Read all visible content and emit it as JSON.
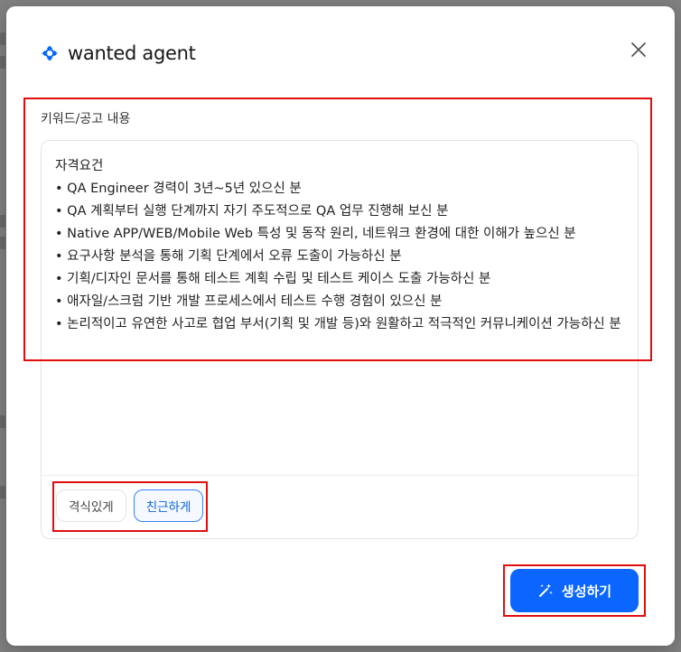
{
  "header": {
    "brand": "wanted agent",
    "brand_color": "#0066ff"
  },
  "form": {
    "field_label": "키워드/공고 내용",
    "content": "자격요건\n• QA Engineer 경력이 3년~5년 있으신 분\n• QA 계획부터 실행 단계까지 자기 주도적으로 QA 업무 진행해 보신 분\n• Native APP/WEB/Mobile Web 특성 및 동작 원리, 네트워크 환경에 대한 이해가 높으신 분\n• 요구사항 분석을 통해 기획 단계에서 오류 도출이 가능하신 분\n• 기획/디자인 문서를 통해 테스트 계획 수립 및 테스트 케이스 도출 가능하신 분\n• 애자일/스크럼 기반 개발 프로세스에서 테스트 수행 경험이 있으신 분\n• 논리적이고 유연한 사고로 협업 부서(기획 및 개발 등)와 원활하고 적극적인 커뮤니케이션 가능하신 분",
    "tones": [
      {
        "label": "격식있게",
        "selected": false
      },
      {
        "label": "친근하게",
        "selected": true
      }
    ]
  },
  "actions": {
    "generate_label": "생성하기",
    "primary_color": "#0b66ff"
  },
  "icons": {
    "close": "close-icon",
    "generate": "magic-wand-icon",
    "logo": "wanted-logo-icon"
  }
}
